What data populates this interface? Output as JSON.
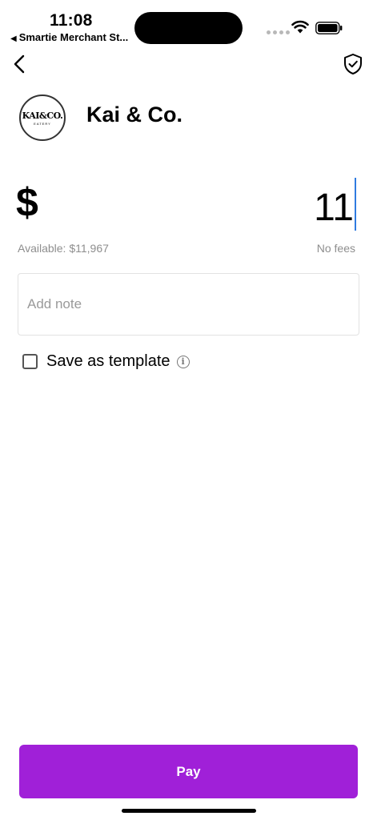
{
  "status_bar": {
    "time": "11:08",
    "back_app": "Smartie Merchant St...",
    "back_arrow": "◀",
    "icons": [
      "signal-dots-icon",
      "wifi-icon",
      "battery-icon"
    ]
  },
  "nav": {
    "back_icon": "chevron-left-icon",
    "shield_icon": "shield-check-icon"
  },
  "merchant": {
    "name": "Kai & Co.",
    "logo_text": "KAI&CO.",
    "logo_subtext": "EATERY"
  },
  "payment": {
    "currency_symbol": "$",
    "amount": "11",
    "available": "Available: $11,967",
    "fees": "No fees"
  },
  "note": {
    "placeholder": "Add note"
  },
  "template": {
    "label": "Save as template",
    "checked": false,
    "info_icon": "i"
  },
  "actions": {
    "pay_label": "Pay"
  },
  "colors": {
    "pay_button": "#a020d8",
    "caret": "#2f7be0",
    "muted_text": "#8e8e8e"
  }
}
